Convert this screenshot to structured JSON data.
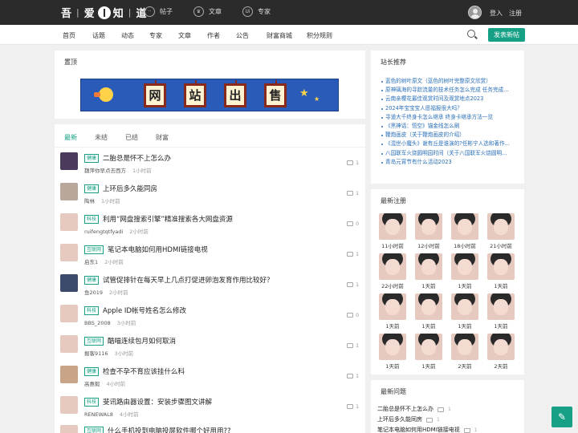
{
  "top": {
    "logo_chars": [
      "吾",
      "爱",
      "知",
      "道"
    ],
    "nav": [
      {
        "label": "帖子",
        "icon": "chat-icon"
      },
      {
        "label": "文章",
        "icon": "crown-icon"
      },
      {
        "label": "专家",
        "icon": "expert-icon"
      }
    ],
    "login": "登入",
    "register": "注册"
  },
  "navbar": {
    "links": [
      "首页",
      "话题",
      "动态",
      "专家",
      "文章",
      "作者",
      "公告",
      "财富商城",
      "积分规则"
    ],
    "post_button": "发表新帖"
  },
  "pinned": {
    "header": "置顶",
    "banner_chars": [
      "网",
      "站",
      "出",
      "售"
    ]
  },
  "feed": {
    "tabs": [
      "最新",
      "未结",
      "已结",
      "财富"
    ],
    "rows": [
      {
        "tag": "健康",
        "title": "二胎总是怀不上怎么办",
        "user": "魏萍你早点去西方",
        "time": "1小时前",
        "comments": "1"
      },
      {
        "tag": "健康",
        "title": "上环后多久能同房",
        "user": "陶林",
        "time": "1小时前",
        "comments": "1"
      },
      {
        "tag": "科技",
        "title": "利用“网盘搜索引擎”精准搜索各大网盘资源",
        "user": "ruifengtqtfyadi",
        "time": "2小时前",
        "comments": "0"
      },
      {
        "tag": "互联网",
        "title": "笔记本电脑如何用HDMI链接电视",
        "user": "启东1",
        "time": "2小时前",
        "comments": "1"
      },
      {
        "tag": "健康",
        "title": "试管促排针在每天早上几点打促进卵泡发育作用比较好？",
        "user": "鱼2019",
        "time": "2小时前",
        "comments": "1"
      },
      {
        "tag": "科技",
        "title": "Apple ID帐号姓名怎么修改",
        "user": "BBS_2008",
        "time": "3小时前",
        "comments": "0"
      },
      {
        "tag": "互联网",
        "title": "酷喵连续包月如何取消",
        "user": "掘客9116",
        "time": "3小时前",
        "comments": "1"
      },
      {
        "tag": "健康",
        "title": "检查不孕不育应该挂什么科",
        "user": "高惠毅",
        "time": "4小时前",
        "comments": "1"
      },
      {
        "tag": "科技",
        "title": "斐讯路由器设置：安装步骤图文讲解",
        "user": "RENEWAL8",
        "time": "4小时前",
        "comments": "1"
      },
      {
        "tag": "互联网",
        "title": "什么手机投到电脑投屏软件哪个好用用??",
        "user": "",
        "time": "",
        "comments": ""
      }
    ]
  },
  "recommend": {
    "header": "站长推荐",
    "items": [
      "蓝色的树叶原文（蓝色的树叶完整原文欣赏）",
      "原神璃海的寻踪流量的技术任务怎么完成 任务完成...",
      "云南亲樱花最佳观赏时间及观赏地点2023",
      "2024年宝宝宝人愿福报很大吗？",
      "寻道大千终身卡怎么继承 终身卡继承方法一览",
      "《黑神话：悟空》锚金线怎么刷",
      "鞭炮画皮（关于鞭炮画皮的介绍）",
      "《混世小魔头》谢有丘是谁演的?任彬宁人选和著作...",
      "八国联军火烧圆明园时间（关于八国联军火烧圆明...",
      "青岛元宵节有什么活动2023"
    ]
  },
  "members": {
    "header": "最新注册",
    "labels": [
      "11小时前",
      "12小时前",
      "18小时前",
      "21小时前",
      "22小时前",
      "1天前",
      "1天前",
      "1天前",
      "1天前",
      "1天前",
      "1天前",
      "1天前",
      "1天前",
      "1天前",
      "2天前",
      "2天前"
    ]
  },
  "newq": {
    "header": "最新问题",
    "items": [
      {
        "title": "二胎总是怀不上怎么办",
        "count": "1"
      },
      {
        "title": "上环后多久能同房",
        "count": "1"
      },
      {
        "title": "笔记本电脑如何用HDMI链接电视",
        "count": "1"
      }
    ]
  },
  "colors": {
    "accent": "#16a085",
    "topbar": "#2b2b2b",
    "link": "#2a6fb8"
  }
}
